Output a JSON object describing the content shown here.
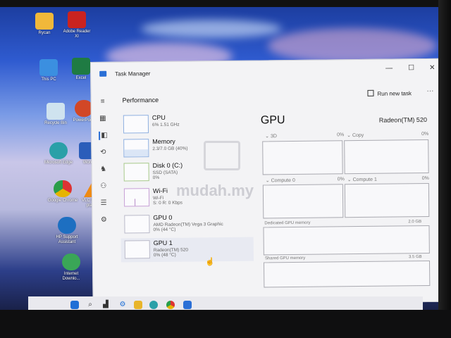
{
  "desktop": {
    "icons": [
      {
        "label": "Rycan",
        "color": "#f1b83a"
      },
      {
        "label": "Adobe Reader XI",
        "color": "#c9231f"
      },
      {
        "label": "This PC",
        "color": "#3b8fe0"
      },
      {
        "label": "Excel",
        "color": "#1f7b43"
      },
      {
        "label": "Recycle Bin",
        "color": "#cfe3ef"
      },
      {
        "label": "PowerPoint",
        "color": "#d24726"
      },
      {
        "label": "Microsoft Edge",
        "color": "#2aa0a8"
      },
      {
        "label": "Word",
        "color": "#2b5dba"
      },
      {
        "label": "Google Chrome",
        "color": "#e6b400"
      },
      {
        "label": "VLC media player",
        "color": "#ef8a12"
      },
      {
        "label": "HP Support Assistant",
        "color": "#1d6fc1"
      },
      {
        "label": "Internet Downlo...",
        "color": "#3aa657"
      }
    ]
  },
  "taskmanager": {
    "title": "Task Manager",
    "section": "Performance",
    "run_new_task": "Run new task",
    "more": "···",
    "win_min": "—",
    "win_max": "☐",
    "win_close": "✕",
    "nav_icons": [
      "≡",
      "▦",
      "◧",
      "⟲",
      "♞",
      "⚇",
      "☰",
      "⚙"
    ],
    "resources": [
      {
        "name": "CPU",
        "sub": "6% 1.51 GHz"
      },
      {
        "name": "Memory",
        "sub": "2.3/7.0 GB (40%)"
      },
      {
        "name": "Disk 0 (C:)",
        "sub": "SSD (SATA)\n0%"
      },
      {
        "name": "Wi-Fi",
        "sub": "Wi-Fi\nS: 0 R: 0 Kbps"
      },
      {
        "name": "GPU 0",
        "sub": "AMD Radeon(TM) Vega 3 Graphic\n0% (44 °C)"
      },
      {
        "name": "GPU 1",
        "sub": "Radeon(TM) 520\n0% (48 °C)"
      }
    ],
    "detail": {
      "title": "GPU",
      "adapter": "Radeon(TM) 520",
      "graphs": [
        {
          "label": "3D",
          "pct": "0%"
        },
        {
          "label": "Copy",
          "pct": "0%"
        },
        {
          "label": "Compute 0",
          "pct": "0%"
        },
        {
          "label": "Compute 1",
          "pct": "0%"
        }
      ],
      "dedicated_label": "Dedicated GPU memory",
      "dedicated_max": "2.0 GB",
      "shared_label": "Shared GPU memory",
      "shared_max": "3.5 GB"
    }
  },
  "watermark": "mudah.my",
  "taskbar": {
    "icons": [
      "windows-icon",
      "search-icon",
      "widgets-icon",
      "settings-icon",
      "explorer-icon",
      "edge-icon",
      "chrome-icon",
      "taskmanager-icon"
    ]
  }
}
